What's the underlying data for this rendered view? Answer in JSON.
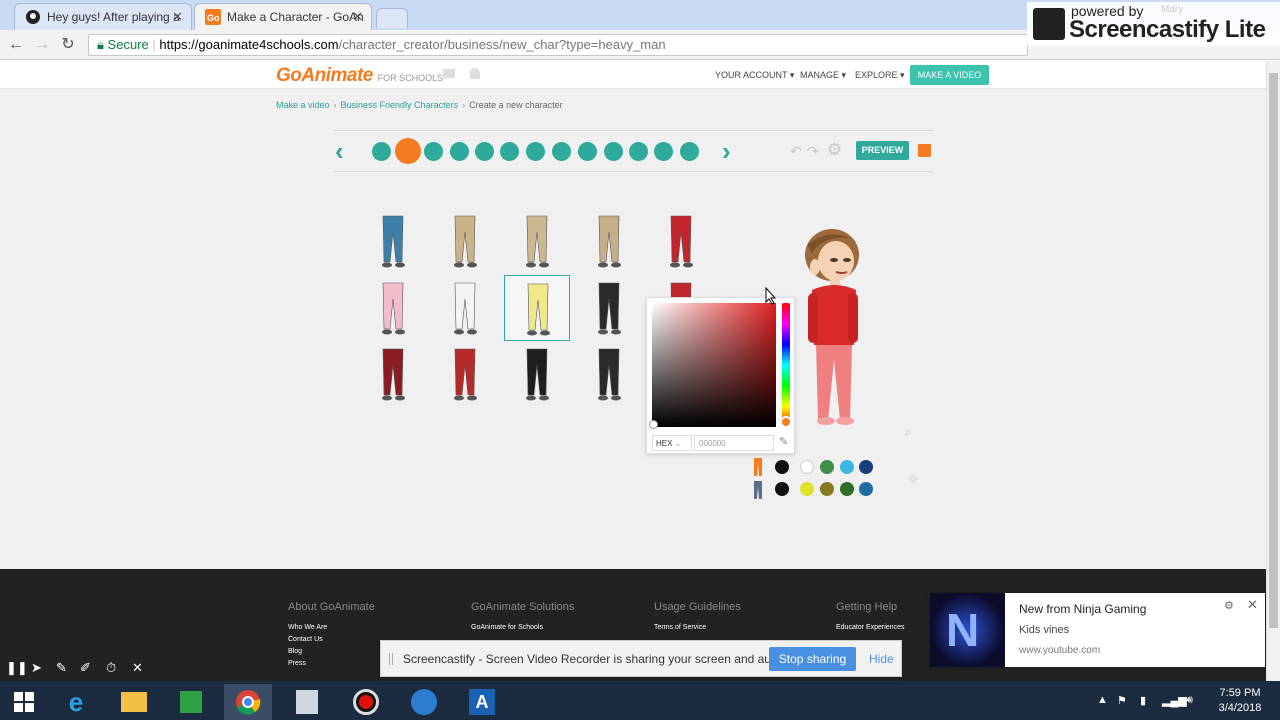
{
  "browser": {
    "tabs": [
      {
        "title": "Hey guys! After playing a",
        "active": false
      },
      {
        "title": "Make a Character - GoAn",
        "active": true
      }
    ],
    "url_secure_label": "Secure",
    "url_host": "https://goanimate4schools.com",
    "url_path": "/character_creator/business/new_char?type=heavy_man"
  },
  "overlay": {
    "powered_by": "powered by",
    "brand": "Screencastify Lite",
    "user": "Mary"
  },
  "site": {
    "logo": "GoAnimate",
    "logo_suffix": "FOR SCHOOLS",
    "nav": [
      {
        "label": "YOUR ACCOUNT ▾"
      },
      {
        "label": "MANAGE ▾"
      },
      {
        "label": "EXPLORE ▾"
      }
    ],
    "make_video": "MAKE A VIDEO"
  },
  "breadcrumb": [
    "Make a video",
    "Business Friendly Characters",
    "Create a new character"
  ],
  "toolbar": {
    "prev": "‹",
    "next": "›",
    "preview": "PREVIEW",
    "category_icons": [
      "shirt-icon",
      "pants-icon",
      "face-icon",
      "hair-icon",
      "mouth-icon",
      "lips-icon",
      "nose-icon",
      "eyebrow-icon",
      "eye-icon",
      "eyelash-icon",
      "hat-icon",
      "glasses-icon",
      "beard-icon"
    ]
  },
  "items": [
    {
      "name": "jeans",
      "color": "#3d7fa8"
    },
    {
      "name": "khaki-skirt",
      "color": "#c9b48a"
    },
    {
      "name": "khaki-shorts",
      "color": "#cbb891"
    },
    {
      "name": "khaki-long-skirt",
      "color": "#c3b08a"
    },
    {
      "name": "red-skirt-boots",
      "color": "#c0262c"
    },
    {
      "name": "pink-pants",
      "color": "#f2bccb"
    },
    {
      "name": "white-skirt",
      "color": "#f4f4f4"
    },
    {
      "name": "yellow-pants",
      "color": "#efe98c"
    },
    {
      "name": "black-pants",
      "color": "#2a2a2a"
    },
    {
      "name": "red-mini-skirt",
      "color": "#c0262c"
    },
    {
      "name": "plaid-skirt",
      "color": "#8b1c24"
    },
    {
      "name": "red-boots",
      "color": "#b82a2a"
    },
    {
      "name": "black-skirt",
      "color": "#1e1e1e"
    },
    {
      "name": "fishnet-skirt",
      "color": "#2a2a2a"
    }
  ],
  "picker": {
    "format": "HEX",
    "value": "000000"
  },
  "swatches": {
    "row1": [
      "#111111",
      "#ffffff",
      "#3e8e4a",
      "#3cb6e3",
      "#173e7a"
    ],
    "row2": [
      "#111111",
      "#e2e22a",
      "#877a1e",
      "#2f6e25",
      "#1c6ea3"
    ]
  },
  "footer": {
    "columns": [
      {
        "heading": "About GoAnimate",
        "links": [
          "Who We Are",
          "Contact Us",
          "Blog",
          "Press"
        ]
      },
      {
        "heading": "GoAnimate Solutions",
        "links": [
          "GoAnimate for Schools"
        ]
      },
      {
        "heading": "Usage Guidelines",
        "links": [
          "Terms of Service"
        ]
      },
      {
        "heading": "Getting Help",
        "links": [
          "Educator Experiences"
        ]
      }
    ]
  },
  "notification": {
    "title": "New from Ninja Gaming",
    "body": "Kids vines",
    "url": "www.youtube.com",
    "image_letter": "N"
  },
  "share_bar": {
    "message": "Screencastify - Screen Video Recorder is sharing your screen and audio.",
    "stop": "Stop sharing",
    "hide": "Hide"
  },
  "clock": {
    "time": "7:59 PM",
    "date": "3/4/2018"
  }
}
